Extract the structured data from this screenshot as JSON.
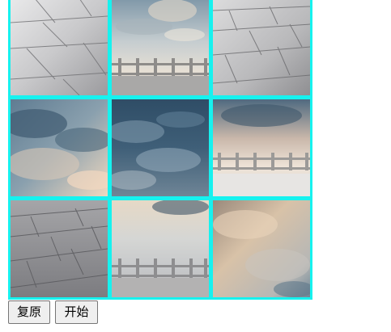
{
  "puzzle": {
    "grid_rows": 3,
    "grid_cols": 3,
    "border_color": "#16f2ef",
    "tiles": [
      {
        "row": 0,
        "col": 0,
        "content": "stone-pavement"
      },
      {
        "row": 0,
        "col": 1,
        "content": "sky-with-railing"
      },
      {
        "row": 0,
        "col": 2,
        "content": "stone-pavement"
      },
      {
        "row": 1,
        "col": 0,
        "content": "cloudy-sky"
      },
      {
        "row": 1,
        "col": 1,
        "content": "dark-cloudy-sky"
      },
      {
        "row": 1,
        "col": 2,
        "content": "sky-with-railing"
      },
      {
        "row": 2,
        "col": 0,
        "content": "stone-pavement"
      },
      {
        "row": 2,
        "col": 1,
        "content": "sky-with-railing"
      },
      {
        "row": 2,
        "col": 2,
        "content": "hazy-sky"
      }
    ]
  },
  "controls": {
    "reset_label": "复原",
    "start_label": "开始"
  }
}
